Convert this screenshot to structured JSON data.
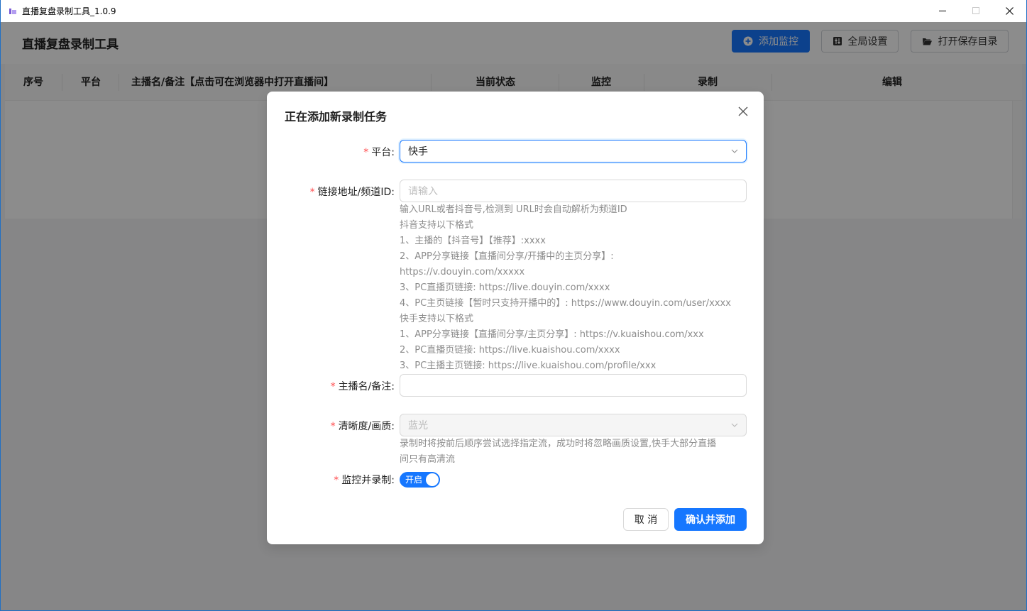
{
  "window": {
    "title": "直播复盘录制工具_1.0.9"
  },
  "header": {
    "app_title": "直播复盘录制工具",
    "add_monitor": "添加监控",
    "global_settings": "全局设置",
    "open_save_dir": "打开保存目录"
  },
  "table": {
    "columns": [
      "序号",
      "平台",
      "主播名/备注【点击可在浏览器中打开直播间】",
      "当前状态",
      "监控",
      "录制",
      "编辑"
    ]
  },
  "dialog": {
    "title": "正在添加新录制任务",
    "platform_label": "平台:",
    "platform_value": "快手",
    "url_label": "链接地址/频道ID:",
    "url_placeholder": "请输入",
    "url_help": [
      "输入URL或者抖音号,检测到 URL时会自动解析为频道ID",
      "抖音支持以下格式",
      "1、主播的【抖音号】【推荐】:xxxx",
      "2、APP分享链接【直播间分享/开播中的主页分享】:",
      "https://v.douyin.com/xxxxx",
      "3、PC直播页链接: https://live.douyin.com/xxxx",
      "4、PC主页链接【暂时只支持开播中的】: https://www.douyin.com/user/xxxx",
      "快手支持以下格式",
      "1、APP分享链接【直播间分享/主页分享】: https://v.kuaishou.com/xxx",
      "2、PC直播页链接: https://live.kuaishou.com/xxxx",
      "3、PC主播主页链接: https://live.kuaishou.com/profile/xxx"
    ],
    "name_label": "主播名/备注:",
    "name_value": "",
    "quality_label": "清晰度/画质:",
    "quality_value": "蓝光",
    "quality_help": [
      "录制时将按前后顺序尝试选择指定流，成功时将忽略画质设置,快手大部分直播",
      "间只有高清流"
    ],
    "monitor_label": "监控并录制:",
    "monitor_switch_text": "开启",
    "monitor_on": true,
    "cancel": "取 消",
    "confirm": "确认并添加"
  },
  "colors": {
    "primary": "#1677ff",
    "required": "#ff4d4f"
  }
}
